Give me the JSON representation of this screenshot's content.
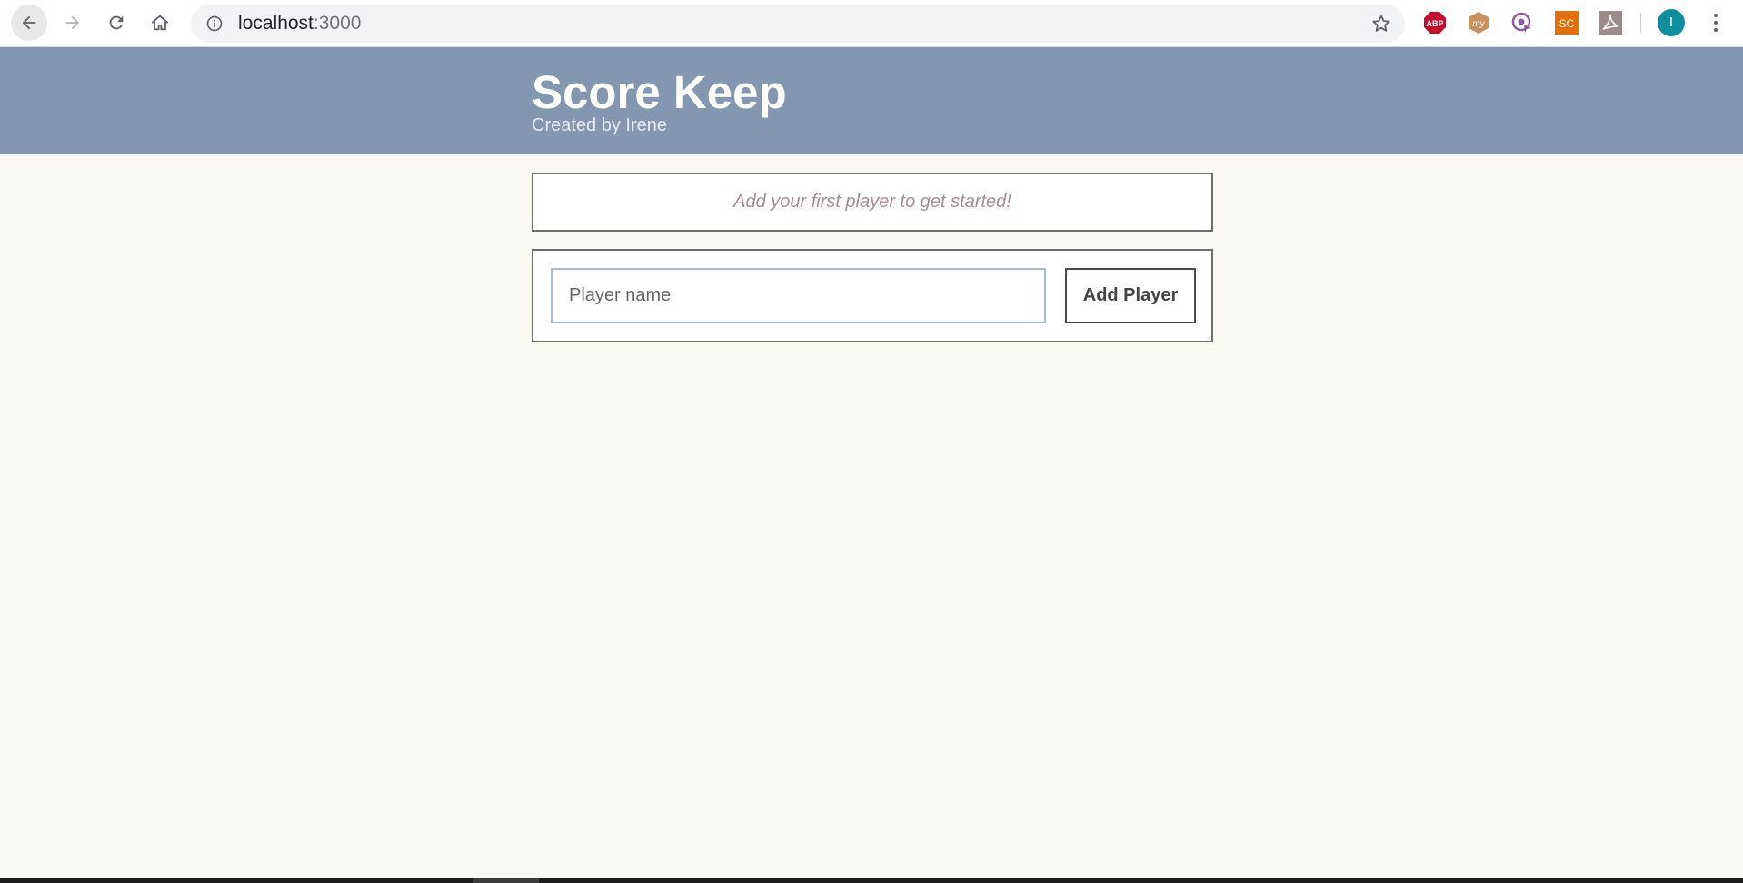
{
  "browser": {
    "url_host": "localhost",
    "url_port": ":3000",
    "icons": {
      "back": "arrow-left-icon",
      "forward": "arrow-right-icon",
      "reload": "reload-icon",
      "home": "home-icon",
      "info": "info-icon",
      "bookmark": "star-icon",
      "menu": "kebab-menu-icon"
    },
    "extensions": [
      {
        "name": "adblock-plus",
        "label": "ABP",
        "color": "#c70d2c"
      },
      {
        "name": "my",
        "label": "my",
        "color": "#c9925d"
      },
      {
        "name": "cast",
        "label": "",
        "color": "#8e5aa8"
      },
      {
        "name": "sc",
        "label": "SC",
        "color": "#e36f0c"
      },
      {
        "name": "pdf",
        "label": "",
        "color": "#9c8a8a"
      }
    ],
    "profile_initial": "I",
    "profile_color": "#0e8f9b"
  },
  "app": {
    "title": "Score Keep",
    "subtitle": "Created by Irene",
    "header_color": "#8397b0",
    "background_color": "#f9f8f2",
    "empty_message": "Add your first player to get started!",
    "form": {
      "input_placeholder": "Player name",
      "input_value": "",
      "button_label": "Add Player"
    }
  }
}
